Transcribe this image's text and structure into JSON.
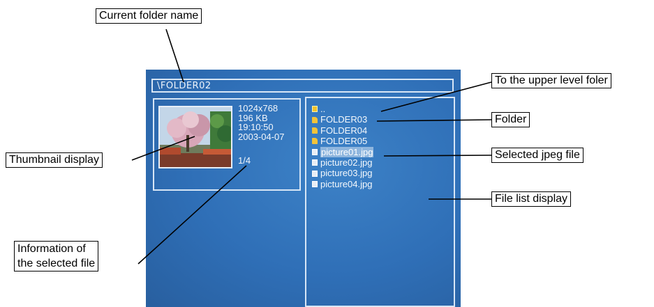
{
  "screen": {
    "folder_path": "\\FOLDER02",
    "info": {
      "resolution": "1024x768",
      "size": "196 KB",
      "time": "19:10:50",
      "date": "2003-04-07",
      "page": "1/4"
    },
    "files": [
      {
        "name": "..",
        "icon": "up-folder-icon"
      },
      {
        "name": "FOLDER03",
        "icon": "folder-icon"
      },
      {
        "name": "FOLDER04",
        "icon": "folder-icon"
      },
      {
        "name": "FOLDER05",
        "icon": "folder-icon"
      },
      {
        "name": "picture01.jpg",
        "icon": "jpeg-file-icon",
        "selected": true
      },
      {
        "name": "picture02.jpg",
        "icon": "jpeg-file-icon"
      },
      {
        "name": "picture03.jpg",
        "icon": "jpeg-file-icon"
      },
      {
        "name": "picture04.jpg",
        "icon": "jpeg-file-icon"
      }
    ]
  },
  "callouts": {
    "current_folder": "Current folder name",
    "upper_level": "To the upper level foler",
    "folder": "Folder",
    "thumbnail": "Thumbnail display",
    "selected_jpeg": "Selected jpeg file",
    "file_list": "File list display",
    "info_line1": "Information of",
    "info_line2": "the selected file"
  },
  "colors": {
    "screen_blue": "#2f6fb7",
    "panel_border": "#d7e6f6",
    "selection_highlight": "#8fb6de",
    "folder_icon": "#f2c33a"
  }
}
